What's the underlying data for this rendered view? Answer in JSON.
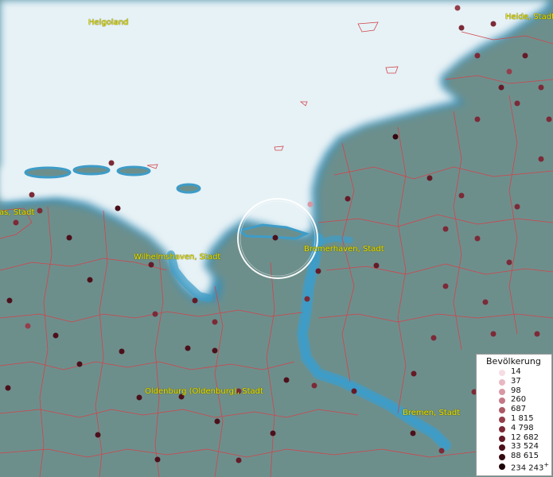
{
  "map": {
    "colors": {
      "sea": "#e7f2f6",
      "land": "#6d8f8c",
      "river": "#3d9cc8",
      "border": "#d2444b",
      "label": "#e8e400"
    },
    "places": [
      {
        "id": "helgoland",
        "name": "Helgoland"
      },
      {
        "id": "heide",
        "name": "Heide, Stadt"
      },
      {
        "id": "left-town",
        "name": "as, Stadt"
      },
      {
        "id": "wilhelmshaven",
        "name": "Wilhelmshaven, Stadt"
      },
      {
        "id": "bremerhaven",
        "name": "Bremerhaven, Stadt"
      },
      {
        "id": "oldenburg",
        "name": "Oldenburg (Oldenburg), Stadt"
      },
      {
        "id": "bremen",
        "name": "Bremen, Stadt"
      }
    ]
  },
  "legend": {
    "title": "Bevölkerung",
    "items": [
      {
        "label": "14",
        "color": "#f6dde3"
      },
      {
        "label": "37",
        "color": "#e8b8c2"
      },
      {
        "label": "98",
        "color": "#d797a4"
      },
      {
        "label": "260",
        "color": "#c47886"
      },
      {
        "label": "687",
        "color": "#ad5966"
      },
      {
        "label": "1 815",
        "color": "#943f4c"
      },
      {
        "label": "4 798",
        "color": "#7c2a37"
      },
      {
        "label": "12 682",
        "color": "#641b27"
      },
      {
        "label": "33 524",
        "color": "#4c101b"
      },
      {
        "label": "88 615",
        "color": "#340810"
      },
      {
        "label": "234 243",
        "color": "#1c0307",
        "suffix": "+"
      }
    ]
  }
}
